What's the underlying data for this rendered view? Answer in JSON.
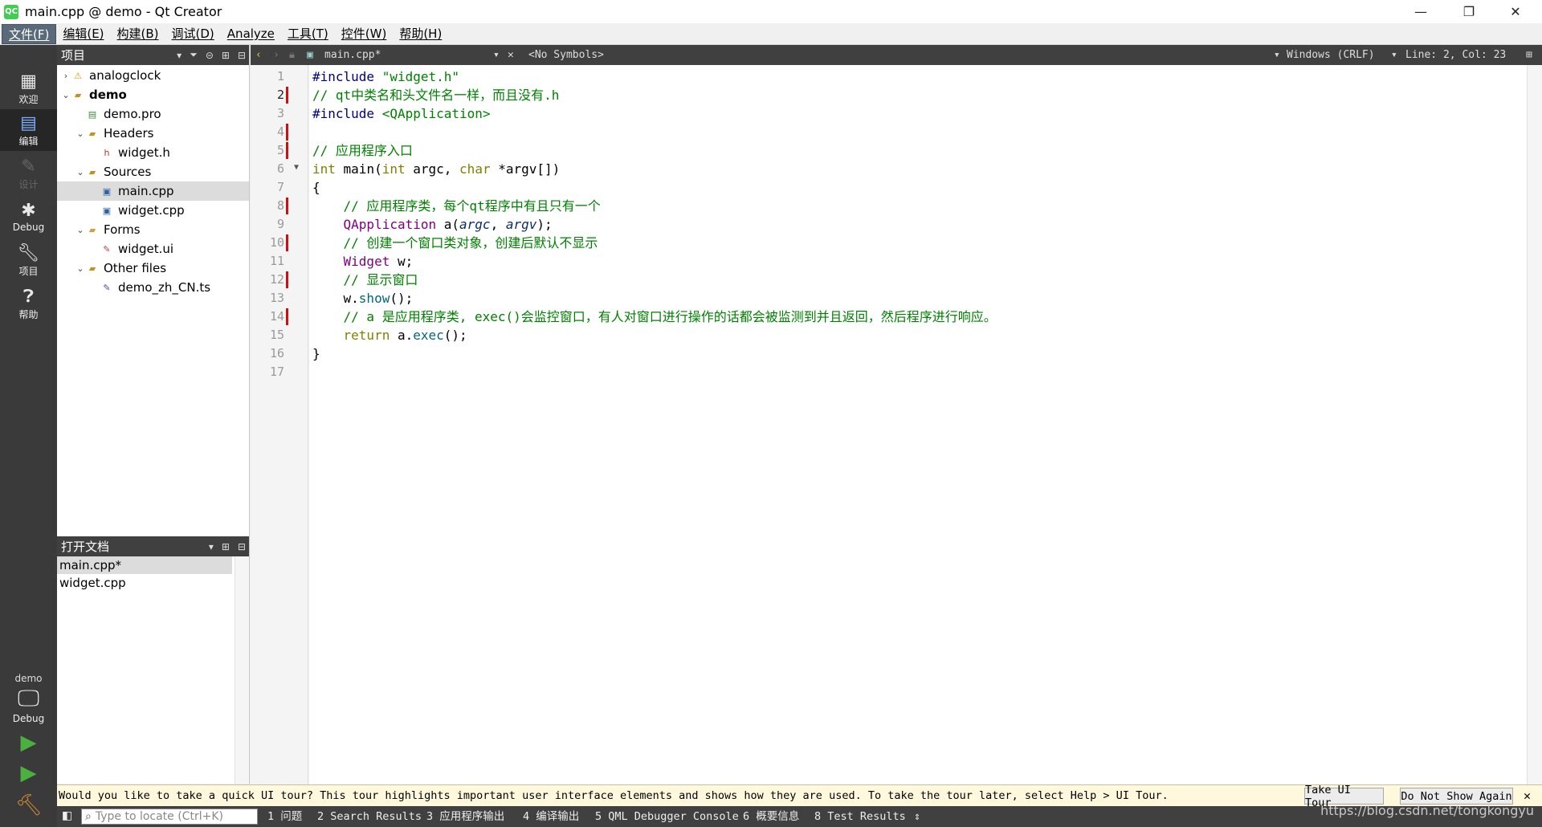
{
  "window": {
    "title": "main.cpp @ demo - Qt Creator",
    "app_badge": "QC",
    "minimize": "—",
    "restore": "❐",
    "close": "✕"
  },
  "menu": [
    "文件(F)",
    "编辑(E)",
    "构建(B)",
    "调试(D)",
    "Analyze",
    "工具(T)",
    "控件(W)",
    "帮助(H)"
  ],
  "modes": {
    "welcome": "欢迎",
    "edit": "编辑",
    "design": "设计",
    "debug": "Debug",
    "projects": "项目",
    "help": "帮助"
  },
  "kit": {
    "project": "demo",
    "build": "Debug"
  },
  "project_panel": {
    "title": "项目",
    "items": [
      {
        "label": "analogclock",
        "indent": 0,
        "arrow": "›",
        "icon": "warning-icon"
      },
      {
        "label": "demo",
        "indent": 0,
        "arrow": "⌄",
        "icon": "project-folder-icon",
        "bold": true
      },
      {
        "label": "demo.pro",
        "indent": 1,
        "arrow": "",
        "icon": "pro-file-icon"
      },
      {
        "label": "Headers",
        "indent": 1,
        "arrow": "⌄",
        "icon": "headers-folder-icon"
      },
      {
        "label": "widget.h",
        "indent": 2,
        "arrow": "",
        "icon": "header-file-icon"
      },
      {
        "label": "Sources",
        "indent": 1,
        "arrow": "⌄",
        "icon": "sources-folder-icon"
      },
      {
        "label": "main.cpp",
        "indent": 2,
        "arrow": "",
        "icon": "cpp-file-icon",
        "selected": true
      },
      {
        "label": "widget.cpp",
        "indent": 2,
        "arrow": "",
        "icon": "cpp-file-icon"
      },
      {
        "label": "Forms",
        "indent": 1,
        "arrow": "⌄",
        "icon": "forms-folder-icon"
      },
      {
        "label": "widget.ui",
        "indent": 2,
        "arrow": "",
        "icon": "ui-file-icon"
      },
      {
        "label": "Other files",
        "indent": 1,
        "arrow": "⌄",
        "icon": "other-folder-icon"
      },
      {
        "label": "demo_zh_CN.ts",
        "indent": 2,
        "arrow": "",
        "icon": "ts-file-icon"
      }
    ]
  },
  "open_docs": {
    "title": "打开文档",
    "items": [
      "main.cpp*",
      "widget.cpp"
    ]
  },
  "editor_toolbar": {
    "file": "main.cpp*",
    "symbols": "<No Symbols>",
    "line_endings": "Windows (CRLF)",
    "position": "Line: 2, Col: 23"
  },
  "code": {
    "current_line": 2,
    "modified_lines": [
      2,
      4,
      5,
      8,
      10,
      12,
      14
    ],
    "line_count": 17
  },
  "infobar": {
    "message": "Would you like to take a quick UI tour? This tour highlights important user interface elements and shows how they are used. To take the tour later, select Help > UI Tour.",
    "take_tour": "Take UI Tour",
    "dont_show": "Do Not Show Again"
  },
  "statusbar": {
    "locator_placeholder": "Type to locate (Ctrl+K)",
    "tabs": [
      "1 问题",
      "2 Search Results",
      "3 应用程序输出",
      "4 编译输出",
      "5 QML Debugger Console",
      "6 概要信息",
      "8 Test Results"
    ]
  },
  "watermark": "https://blog.csdn.net/tongkongyu"
}
